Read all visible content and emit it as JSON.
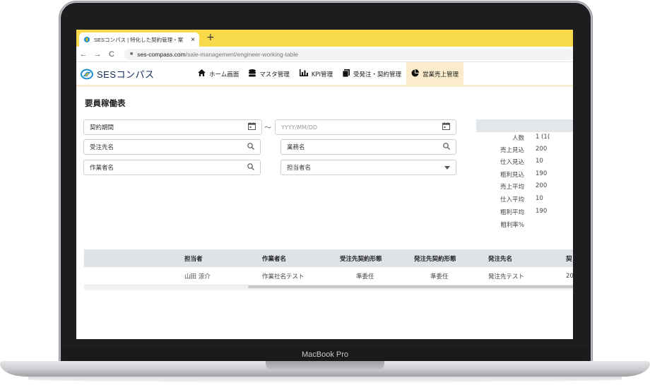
{
  "device": {
    "label": "MacBook Pro"
  },
  "browser": {
    "tab_title": "SESコンパス | 特化した契約管理・案",
    "tab_close": "×",
    "new_tab": "+",
    "back": "←",
    "forward": "→",
    "reload": "C",
    "url_host": "ses-compass.com",
    "url_path": "/sale-management/engineer-working-table"
  },
  "app": {
    "logo_text": "SESコンパス",
    "menu": [
      {
        "label": "ホーム画面",
        "icon": "home-icon"
      },
      {
        "label": "マスタ管理",
        "icon": "database-icon"
      },
      {
        "label": "KPI管理",
        "icon": "bar-chart-icon"
      },
      {
        "label": "受発注・契約管理",
        "icon": "document-icon"
      },
      {
        "label": "営業売上管理",
        "icon": "pie-chart-icon"
      }
    ],
    "colors": {
      "accent": "#f7d94b",
      "active_menu": "#fbeccb",
      "brand_navy": "#0f2a5c",
      "brand_blue": "#1a8fd6",
      "brand_yellow": "#f5c400"
    }
  },
  "page": {
    "title": "要員稼働表",
    "filters": {
      "contract_period": "契約期間",
      "date_separator": "～",
      "date_placeholder": "YYYY/MM/DD",
      "client_name": "受注先名",
      "business_name": "業務名",
      "worker_name": "作業者名",
      "person_in_charge": "担当者名"
    },
    "summary": [
      {
        "key": "人数",
        "value": "1 (1("
      },
      {
        "key": "売上見込",
        "value": "200"
      },
      {
        "key": "仕入見込",
        "value": "10"
      },
      {
        "key": "粗利見込",
        "value": "190"
      },
      {
        "key": "売上平均",
        "value": "200"
      },
      {
        "key": "仕入平均",
        "value": "10"
      },
      {
        "key": "粗利平均",
        "value": "190"
      },
      {
        "key": "粗利率%",
        "value": ""
      }
    ],
    "table": {
      "headers": [
        "担当者",
        "作業者名",
        "受注先契約形態",
        "発注先契約形態",
        "発注先名",
        "契"
      ],
      "rows": [
        [
          "山田 涼介",
          "作業社名テスト",
          "準委任",
          "準委任",
          "発注先テスト",
          "20"
        ]
      ]
    }
  }
}
